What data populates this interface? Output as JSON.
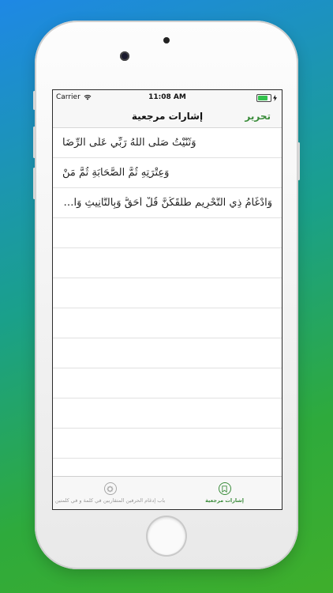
{
  "status": {
    "carrier": "Carrier",
    "time": "11:08 AM",
    "battery_level": 0.8
  },
  "navbar": {
    "title": "إشارات مرجعية",
    "edit_label": "تحرير"
  },
  "bookmarks": [
    "وَثَنَّيْتُ صَلَّى اللهُ رَبِّي عَلَى الرِّضَا",
    "وَعِتْرَتِهِ ثُمَّ الصَّحَابَةِ ثُمَّ مَنْ",
    "وَادْغَامُ ذِي التَّحْرِيمِ طَلَّقَكُنَّ قُلْ أَحَقُّ وَبِالتَّأْنِيثِ وَالْجَمْعِ"
  ],
  "tabbar": {
    "tabs": [
      {
        "label": "إشارات مرجعية",
        "icon": "bookmark-icon",
        "active": true
      },
      {
        "label": "باب إدغام الحرفين المتقاربين في كلمة و في كلمتين",
        "icon": "ornament-icon",
        "active": false
      }
    ]
  },
  "colors": {
    "accent": "#3a8c3a",
    "battery": "#33c24d"
  }
}
